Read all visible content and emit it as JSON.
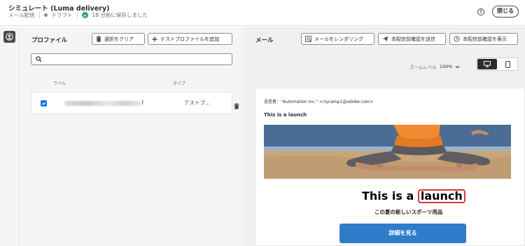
{
  "header": {
    "title": "シミュレート (Luma delivery)",
    "channel": "メール配信",
    "status": "ドラフト",
    "saved": "18 分前に保存しました",
    "help": "?",
    "close_label": "閉じる"
  },
  "profiles": {
    "title": "プロファイル",
    "clear_label": "選択をクリア",
    "add_label": "テストプロファイルを追加",
    "search_placeholder": "",
    "columns": {
      "label": "ラベル",
      "type": "タイプ"
    },
    "rows": [
      {
        "label_suffix": ")",
        "type": "テストプ...",
        "checked": true
      }
    ]
  },
  "email": {
    "title": "メール",
    "render_label": "メールをレンダリング",
    "send_proof_label": "本配信前確認を送信",
    "view_proof_label": "本配信前確認を表示",
    "zoom_label": "ズームレベル",
    "zoom_value": "100%",
    "device": "desktop",
    "preview": {
      "sender": "送信者：\"Automation Inc.\" <rlycamp1@adobe.com>",
      "subject": "This is a launch",
      "heading_prefix": "This is a ",
      "heading_highlight": "launch",
      "subheading": "この夏の新しいスポーツ用品",
      "cta": "詳細を見る"
    }
  },
  "colors": {
    "accent": "#1473e6",
    "cta": "#2f7dc8",
    "success": "#2d9d78",
    "highlight": "#d7373f"
  }
}
